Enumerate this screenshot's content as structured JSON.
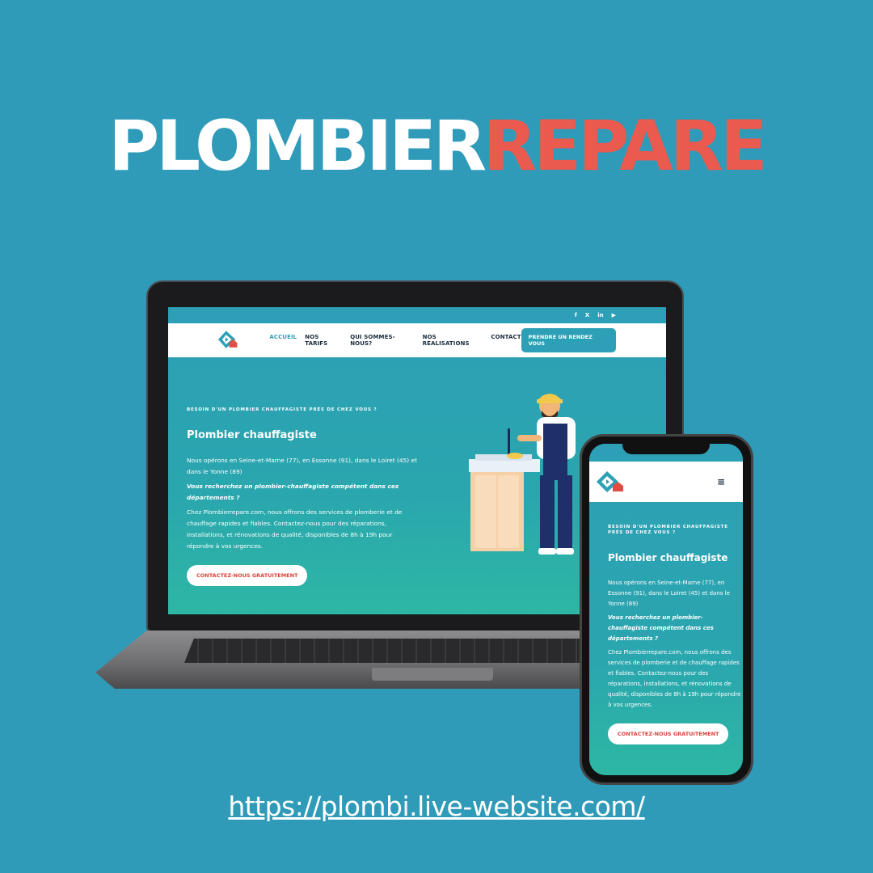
{
  "brand": {
    "part1": "PLOMBIER",
    "part2": "REPARE",
    "colors": {
      "white": "#ffffff",
      "accent": "#ea5a4f"
    }
  },
  "desktop": {
    "social_icons": [
      "facebook-icon",
      "x-icon",
      "linkedin-icon",
      "youtube-icon"
    ],
    "social_labels": {
      "facebook": "f",
      "x": "X",
      "linkedin": "in",
      "youtube": "▶"
    },
    "nav": {
      "items": [
        {
          "label": "ACCUEIL",
          "active": true
        },
        {
          "label": "NOS TARIFS"
        },
        {
          "label": "QUI SOMMES-NOUS?"
        },
        {
          "label": "NOS RÉALISATIONS"
        },
        {
          "label": "CONTACT"
        }
      ],
      "cta": "PRENDRE UN RENDEZ VOUS"
    },
    "hero": {
      "eyebrow": "BESOIN D'UN PLOMBIER CHAUFFAGISTE PRÈS DE CHEZ VOUS ?",
      "title": "Plombier chauffagiste",
      "p1": "Nous opérons en Seine-et-Marne (77), en Essonne (91), dans le Loiret (45) et dans le Yonne (89)",
      "p_italic": "Vous recherchez un plombier-chauffagiste compétent dans ces départements ?",
      "p2": "Chez Plombierrepare.com, nous offrons des services de plomberie et de chauffage rapides et fiables. Contactez-nous pour des réparations, installations, et rénovations de qualité, disponibles de 8h à 19h pour répondre à vos urgences.",
      "cta": "CONTACTEZ-NOUS GRATUITEMENT"
    }
  },
  "mobile": {
    "menu_icon": "hamburger-menu-icon",
    "menu_glyph": "≡",
    "hero": {
      "eyebrow": "BESOIN D'UN PLOMBIER CHAUFFAGISTE PRÈS DE CHEZ VOUS ?",
      "title": "Plombier chauffagiste",
      "p1": "Nous opérons en Seine-et-Marne (77), en Essonne (91), dans le Loiret (45) et dans le Yonne (89)",
      "p_italic": "Vous recherchez un plombier-chauffagiste compétent dans ces départements ?",
      "p2": "Chez Plombierrepare.com, nous offrons des services de plomberie et de chauffage rapides et fiables. Contactez-nous pour des réparations, installations, et rénovations de qualité, disponibles de 8h à 19h pour répondre à vos urgences.",
      "cta": "CONTACTEZ-NOUS GRATUITEMENT"
    }
  },
  "url": "https://plombi.live-website.com/",
  "colors": {
    "background": "#2f9bb9",
    "teal": "#2d9fb6",
    "cta_text": "#d9423a"
  }
}
